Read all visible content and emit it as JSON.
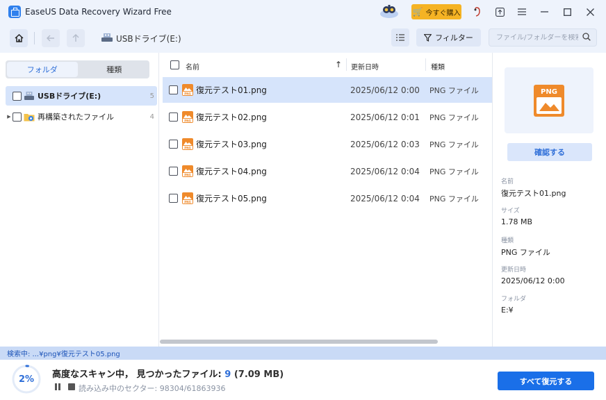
{
  "app": {
    "title": "EaseUS Data Recovery Wizard Free"
  },
  "titlebar": {
    "buy_label": "今すぐ購入"
  },
  "toolbar": {
    "path": "USBドライブ(E:)",
    "filter_label": "フィルター",
    "search_placeholder": "ファイル/フォルダーを検索"
  },
  "left": {
    "tabs": [
      {
        "label": "フォルダ",
        "active": true
      },
      {
        "label": "種類",
        "active": false
      }
    ],
    "tree": [
      {
        "label": "USBドライブ(E:)",
        "count": "5"
      },
      {
        "label": "再構築されたファイル",
        "count": "4"
      }
    ]
  },
  "list": {
    "columns": {
      "name": "名前",
      "modified": "更新日時",
      "type": "種類"
    },
    "sort_indicator": "↑",
    "rows": [
      {
        "name": "復元テスト01.png",
        "date": "2025/06/12 0:00",
        "type": "PNG ファイル",
        "selected": true
      },
      {
        "name": "復元テスト02.png",
        "date": "2025/06/12 0:01",
        "type": "PNG ファイル",
        "selected": false
      },
      {
        "name": "復元テスト03.png",
        "date": "2025/06/12 0:03",
        "type": "PNG ファイル",
        "selected": false
      },
      {
        "name": "復元テスト04.png",
        "date": "2025/06/12 0:04",
        "type": "PNG ファイル",
        "selected": false
      },
      {
        "name": "復元テスト05.png",
        "date": "2025/06/12 0:04",
        "type": "PNG ファイル",
        "selected": false
      }
    ]
  },
  "details": {
    "preview_badge": "PNG",
    "confirm_label": "確認する",
    "fields": [
      {
        "label": "名前",
        "value": "復元テスト01.png"
      },
      {
        "label": "サイズ",
        "value": "1.78 MB"
      },
      {
        "label": "種類",
        "value": "PNG ファイル"
      },
      {
        "label": "更新日時",
        "value": "2025/06/12 0:00"
      },
      {
        "label": "フォルダ",
        "value": "E:¥"
      }
    ]
  },
  "status": {
    "searching": "検索中: ...¥png¥復元テスト05.png",
    "progress_percent": 2,
    "progress_label": "2%",
    "scan_text": "高度なスキャン中，  見つかったファイル: ",
    "found_count": "9",
    "found_size": " (7.09 MB)",
    "sector_text": "読み込み中のセクター: 98304/61863936",
    "recover_all_label": "すべて復元する"
  },
  "colors": {
    "accent": "#1a6fe8",
    "selection": "#d6e4fb",
    "chrome": "#eef3fc",
    "buy": "#f5b324"
  },
  "icons": {
    "titlebar": [
      "binoculars-mascot-icon",
      "cart-icon",
      "share-icon",
      "upload-icon",
      "menu-icon",
      "minimize-icon",
      "maximize-icon",
      "close-icon"
    ],
    "toolbar": [
      "home-icon",
      "back-icon",
      "up-icon",
      "usb-drive-icon",
      "list-view-icon",
      "filter-icon",
      "search-icon"
    ]
  }
}
